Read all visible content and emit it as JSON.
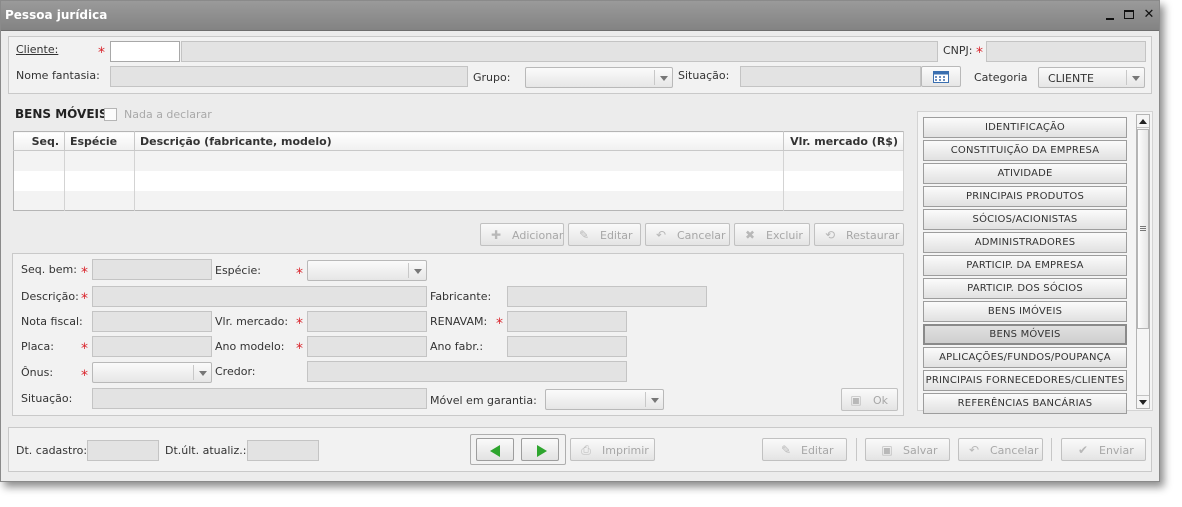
{
  "window": {
    "title": "Pessoa jurídica"
  },
  "header": {
    "cliente_label": "Cliente:",
    "cnpj_label": "CNPJ:",
    "nome_fantasia_label": "Nome fantasia:",
    "grupo_label": "Grupo:",
    "situacao_label": "Situação:",
    "categoria_label": "Categoria",
    "categoria_value": "CLIENTE"
  },
  "bens": {
    "title": "BENS MÓVEIS",
    "nada_label": "Nada a declarar",
    "columns": [
      "Seq.",
      "Espécie",
      "Descrição (fabricante, modelo)",
      "Vlr. mercado (R$)"
    ],
    "actions": [
      "Adicionar",
      "Editar",
      "Cancelar",
      "Excluir",
      "Restaurar"
    ]
  },
  "form": {
    "seq_label": "Seq. bem:",
    "especie_label": "Espécie:",
    "descricao_label": "Descrição:",
    "fabricante_label": "Fabricante:",
    "nota_label": "Nota fiscal:",
    "vlr_label": "Vlr. mercado:",
    "renavam_label": "RENAVAM:",
    "placa_label": "Placa:",
    "ano_modelo_label": "Ano modelo:",
    "ano_fabr_label": "Ano fabr.:",
    "onus_label": "Ônus:",
    "credor_label": "Credor:",
    "situacao_label": "Situação:",
    "movel_label": "Móvel em garantia:",
    "ok_label": "Ok"
  },
  "nav": {
    "items": [
      "IDENTIFICAÇÃO",
      "CONSTITUIÇÃO DA EMPRESA",
      "ATIVIDADE",
      "PRINCIPAIS PRODUTOS",
      "SÓCIOS/ACIONISTAS",
      "ADMINISTRADORES",
      "PARTICIP. DA EMPRESA",
      "PARTICIP. DOS SÓCIOS",
      "BENS IMÓVEIS",
      "BENS MÓVEIS",
      "APLICAÇÕES/FUNDOS/POUPANÇA",
      "PRINCIPAIS FORNECEDORES/CLIENTES",
      "REFERÊNCIAS BANCÁRIAS"
    ],
    "active": "BENS MÓVEIS"
  },
  "footer": {
    "dt_cadastro_label": "Dt. cadastro:",
    "dt_atualiz_label": "Dt.últ. atualiz.:",
    "imprimir_label": "Imprimir",
    "editar_label": "Editar",
    "salvar_label": "Salvar",
    "cancelar_label": "Cancelar",
    "enviar_label": "Enviar"
  },
  "colors": {
    "required": "#d9232a",
    "nav_arrow": "#2ea52e",
    "titlebar": "#8f8f8f"
  }
}
